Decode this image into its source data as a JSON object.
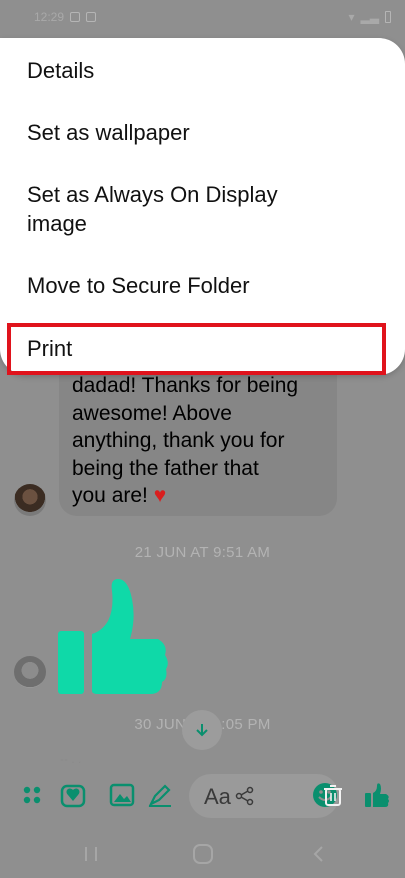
{
  "status_bar": {
    "time": "12:29"
  },
  "menu": {
    "items": [
      {
        "label": "Details"
      },
      {
        "label": "Set as wallpaper"
      },
      {
        "label": "Set as Always On Display image"
      },
      {
        "label": "Move to Secure Folder"
      },
      {
        "label": "Print"
      }
    ],
    "highlighted_index": 4,
    "highlight_color": "#e0131c"
  },
  "conversation": {
    "message_lines": [
      "dadad! Thanks for being",
      "awesome! Above",
      "anything, thank you for",
      "being the father that",
      "you are!"
    ],
    "message_emoji": "♥",
    "timestamp_1": "21 JUN AT 9:51 AM",
    "timestamp_2": "30 JUN AT 9:05 PM",
    "typing_text": "-- . ."
  },
  "toolbar": {
    "input_placeholder": "Aa",
    "accent_color": "#0fd9a8"
  },
  "icons": {
    "status": [
      "signal-icon",
      "wifi-icon",
      "battery-icon"
    ],
    "toolbar": [
      "menu-dots-icon",
      "gif-sticker-icon",
      "image-icon",
      "mic-pen-icon",
      "share-icon",
      "emoji-icon",
      "trash-icon",
      "like-icon"
    ],
    "nav": [
      "recents-icon",
      "home-icon",
      "back-icon"
    ]
  }
}
